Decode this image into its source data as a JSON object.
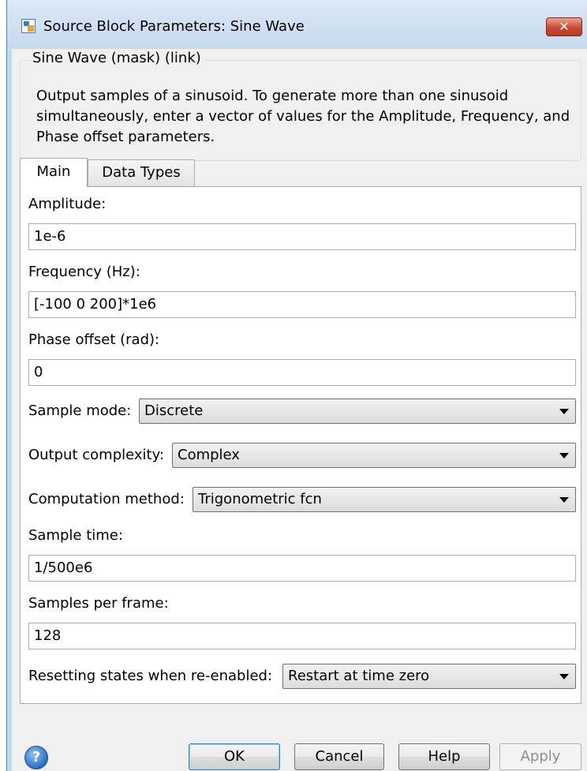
{
  "window": {
    "title": "Source Block Parameters: Sine Wave",
    "close_label": "✕"
  },
  "group": {
    "legend": "Sine Wave (mask) (link)",
    "description": "Output samples of a sinusoid.  To generate more than one sinusoid simultaneously, enter a vector of values for the Amplitude, Frequency, and Phase offset parameters."
  },
  "tabs": [
    {
      "label": "Main",
      "active": true
    },
    {
      "label": "Data Types",
      "active": false
    }
  ],
  "params": {
    "amplitude": {
      "label": "Amplitude:",
      "value": "1e-6"
    },
    "frequency": {
      "label": "Frequency (Hz):",
      "value": "[-100 0 200]*1e6"
    },
    "phase": {
      "label": "Phase offset (rad):",
      "value": "0"
    },
    "sample_mode": {
      "label": "Sample mode:",
      "value": "Discrete"
    },
    "output_complexity": {
      "label": "Output complexity:",
      "value": "Complex"
    },
    "computation_method": {
      "label": "Computation method:",
      "value": "Trigonometric fcn"
    },
    "sample_time": {
      "label": "Sample time:",
      "value": "1/500e6"
    },
    "samples_per_frame": {
      "label": "Samples per frame:",
      "value": "128"
    },
    "resetting_states": {
      "label": "Resetting states when re-enabled:",
      "value": "Restart at time zero"
    }
  },
  "buttons": {
    "help_icon": "?",
    "ok": "OK",
    "cancel": "Cancel",
    "help": "Help",
    "apply": "Apply"
  }
}
